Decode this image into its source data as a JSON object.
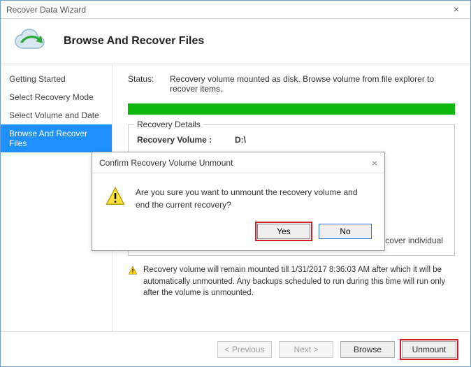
{
  "window": {
    "title": "Recover Data Wizard"
  },
  "header": {
    "page_title": "Browse And Recover Files"
  },
  "sidebar": {
    "items": [
      {
        "label": "Getting Started"
      },
      {
        "label": "Select Recovery Mode"
      },
      {
        "label": "Select Volume and Date"
      },
      {
        "label": "Browse And Recover Files"
      }
    ]
  },
  "main": {
    "status_label": "Status:",
    "status_text": "Recovery volume mounted as disk. Browse volume from file explorer to recover items.",
    "group_title": "Recovery Details",
    "recovery_volume_label": "Recovery Volume  :",
    "recovery_volume_value": "D:\\",
    "partial_right_text": "cover individual",
    "note": "Recovery volume will remain mounted till 1/31/2017 8:36:03 AM after which it will be automatically unmounted. Any backups scheduled to run during this time will run only after the volume is unmounted."
  },
  "footer": {
    "previous": "< Previous",
    "next": "Next >",
    "browse": "Browse",
    "unmount": "Unmount"
  },
  "dialog": {
    "title": "Confirm Recovery Volume Unmount",
    "message": "Are you sure you want to unmount the recovery volume and end the current recovery?",
    "yes": "Yes",
    "no": "No"
  }
}
